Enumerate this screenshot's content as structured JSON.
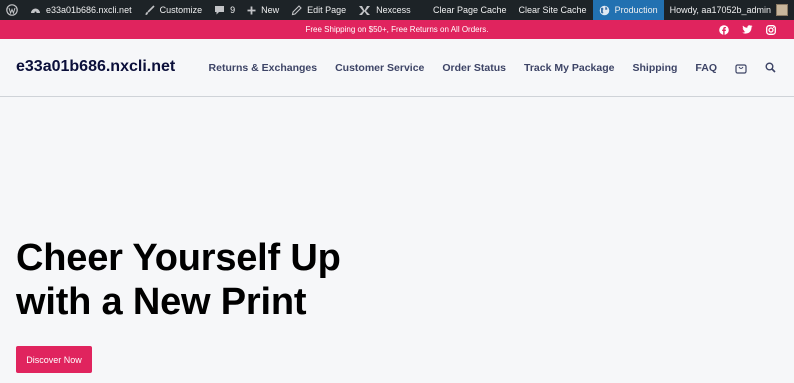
{
  "admin_bar": {
    "site": "e33a01b686.nxcli.net",
    "customize": "Customize",
    "comments_count": "9",
    "new": "New",
    "edit_page": "Edit Page",
    "nexcess": "Nexcess",
    "clear_page_cache": "Clear Page Cache",
    "clear_site_cache": "Clear Site Cache",
    "environment": "Production",
    "greeting": "Howdy, aa17052b_admin"
  },
  "promo": {
    "text": "Free Shipping on $50+, Free Returns on All Orders.",
    "social_icons": [
      "facebook-icon",
      "twitter-icon",
      "instagram-icon"
    ]
  },
  "header": {
    "site_title": "e33a01b686.nxcli.net",
    "nav": [
      "Returns & Exchanges",
      "Customer Service",
      "Order Status",
      "Track My Package",
      "Shipping",
      "FAQ"
    ]
  },
  "hero": {
    "title_line1": "Cheer Yourself Up",
    "title_line2": "with a New Print",
    "cta": "Discover Now"
  },
  "colors": {
    "admin_bar_bg": "#1d2327",
    "accent": "#e0245e",
    "production_bg": "#2271b1",
    "nav_text": "#3d4466",
    "title_text": "#0b0f3a"
  }
}
